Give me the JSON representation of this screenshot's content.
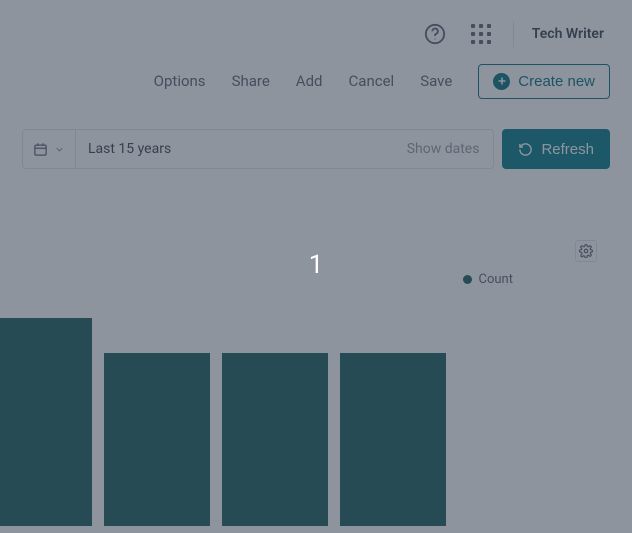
{
  "topbar": {
    "username": "Tech Writer"
  },
  "actions": {
    "options": "Options",
    "share": "Share",
    "add": "Add",
    "cancel": "Cancel",
    "save": "Save",
    "create": "Create new"
  },
  "filter": {
    "range_label": "Last 15 years",
    "show_dates": "Show dates",
    "refresh": "Refresh"
  },
  "chart": {
    "highlight_value": "1",
    "legend_label": "Count"
  },
  "chart_data": {
    "type": "bar",
    "title": "",
    "xlabel": "",
    "ylabel": "",
    "series": [
      {
        "name": "Count",
        "values": [
          1.2,
          1.0,
          1.0,
          1.0
        ]
      }
    ],
    "categories": [
      "",
      "",
      "",
      ""
    ],
    "ylim": [
      0,
      1.3
    ],
    "colors": {
      "Count": "#2f6c6e"
    }
  }
}
